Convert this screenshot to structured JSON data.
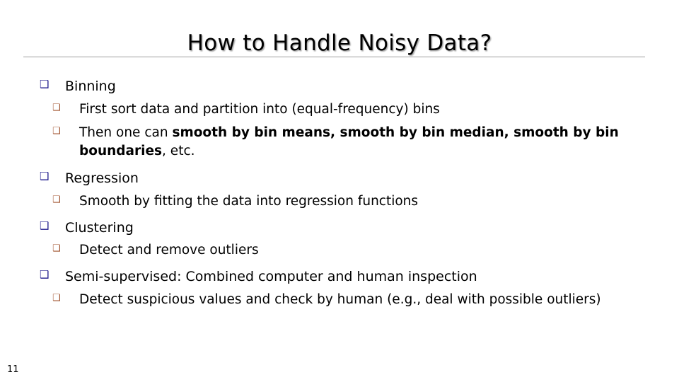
{
  "slide": {
    "title": "How to Handle Noisy Data?",
    "page_number": "11",
    "colors": {
      "level1_bullet": "#1f1a8c",
      "level2_bullet": "#a0522d",
      "rule": "#9d9d9d",
      "text": "#000000",
      "background": "#ffffff"
    },
    "bullet_glyph": "❑",
    "content": [
      {
        "level": 1,
        "bullet": "❑",
        "text": "Binning"
      },
      {
        "level": 2,
        "bullet": "❑",
        "text": "First sort data and partition into (equal-frequency) bins"
      },
      {
        "level": 2,
        "bullet": "❑",
        "text_plain_1": "Then one can ",
        "text_bold": "smooth by bin means, smooth by bin median, smooth by bin boundaries",
        "text_plain_2": ", etc.",
        "text": "Then one can smooth by bin means, smooth by bin median, smooth by bin boundaries, etc."
      },
      {
        "level": 1,
        "bullet": "❑",
        "text": "Regression"
      },
      {
        "level": 2,
        "bullet": "❑",
        "text": "Smooth by fitting the data into regression functions"
      },
      {
        "level": 1,
        "bullet": "❑",
        "text": "Clustering"
      },
      {
        "level": 2,
        "bullet": "❑",
        "text": "Detect and remove outliers"
      },
      {
        "level": 1,
        "bullet": "❑",
        "text": "Semi-supervised: Combined computer and human inspection"
      },
      {
        "level": 2,
        "bullet": "❑",
        "text": "Detect suspicious values and check by human (e.g., deal with possible outliers)"
      }
    ]
  }
}
